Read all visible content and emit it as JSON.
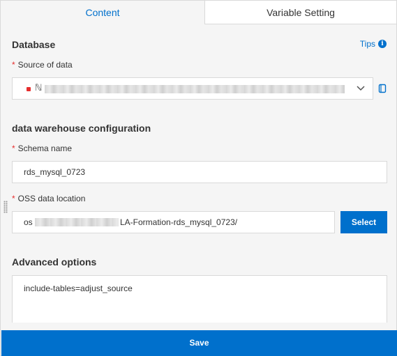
{
  "tabs": [
    {
      "label": "Content",
      "active": true
    },
    {
      "label": "Variable Setting",
      "active": false
    }
  ],
  "database": {
    "title": "Database",
    "tips_label": "Tips",
    "source_label": "Source of data",
    "source_value_glyph": "ℕ"
  },
  "warehouse": {
    "title": "data warehouse configuration",
    "schema_label": "Schema name",
    "schema_value": "rds_mysql_0723",
    "oss_label": "OSS data location",
    "oss_value_prefix": "os",
    "oss_value_suffix": "LA-Formation-rds_mysql_0723/",
    "select_button": "Select"
  },
  "advanced": {
    "title": "Advanced options",
    "value": "include-tables=adjust_source"
  },
  "footer": {
    "save_label": "Save"
  },
  "colors": {
    "accent": "#0070cc",
    "required": "#e62e2e",
    "border": "#d9d9d9",
    "panel_bg": "#f5f5f5"
  },
  "icons": {
    "tips": "info-icon",
    "dropdown": "chevron-down-icon",
    "source_helper": "book-icon",
    "resize": "drag-handle-icon"
  }
}
